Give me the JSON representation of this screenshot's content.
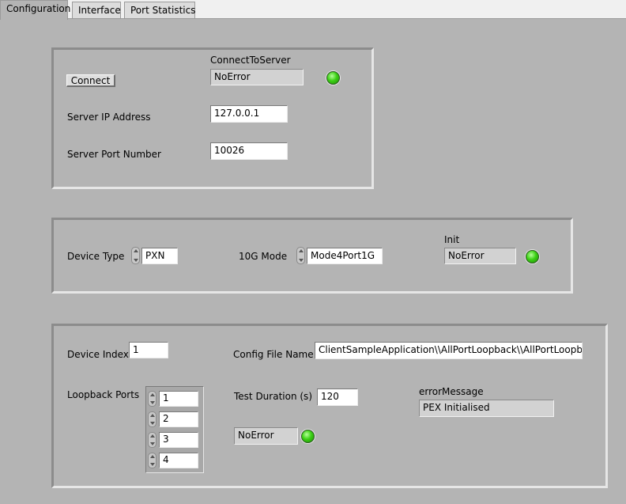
{
  "tabs": [
    {
      "label": "Configuration"
    },
    {
      "label": "Interface"
    },
    {
      "label": "Port Statistics"
    }
  ],
  "server": {
    "connect_button": "Connect",
    "connect_caption": "ConnectToServer",
    "connect_status": "NoError",
    "ip_label": "Server IP Address",
    "ip_value": "127.0.0.1",
    "port_label": "Server Port  Number",
    "port_value": "10026"
  },
  "device": {
    "type_label": "Device Type",
    "type_value": "PXN",
    "mode_label": "10G Mode",
    "mode_value": "Mode4Port1G",
    "init_caption": "Init",
    "init_status": "NoError"
  },
  "test": {
    "index_label": "Device Index",
    "index_value": "1",
    "config_label": "Config File Name",
    "config_value": "ClientSampleApplication\\\\AllPortLoopback\\\\AllPortLoopback",
    "loopback_label": "Loopback Ports",
    "loopback_ports": [
      "1",
      "2",
      "3",
      "4"
    ],
    "duration_label": "Test Duration (s)",
    "duration_value": "120",
    "error_caption": "errorMessage",
    "error_value": "PEX Initialised",
    "status": "NoError"
  },
  "colors": {
    "led_on": "#3bd014",
    "background": "#b4b4b4"
  }
}
